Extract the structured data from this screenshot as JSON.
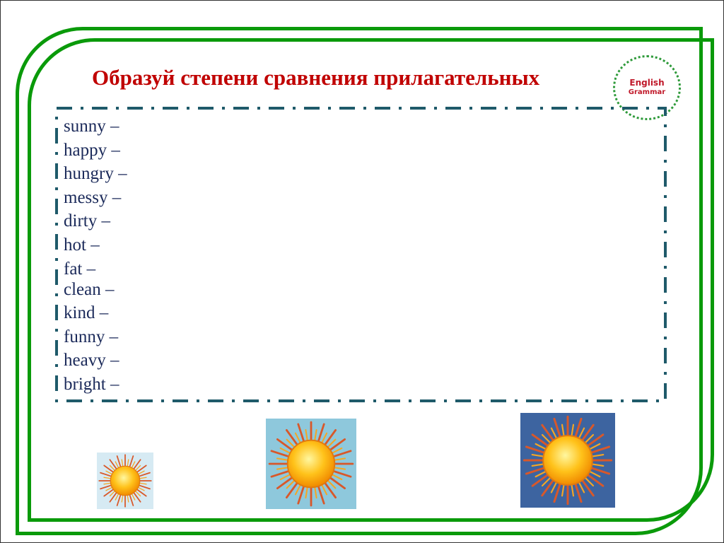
{
  "slide": {
    "title": "Образуй степени сравнения прилагательных",
    "badge": {
      "line1": "English",
      "line2": "Grammar"
    },
    "words": [
      "sunny –",
      "happy –",
      "hungry –",
      "messy –",
      "dirty –",
      "hot –",
      "fat –",
      "clean –",
      "kind –",
      "funny –",
      "heavy –",
      "bright –"
    ],
    "images": [
      {
        "name": "sun-small",
        "icon": "sun-icon",
        "background": "#d6eaf3"
      },
      {
        "name": "sun-medium",
        "icon": "sun-icon",
        "background": "#8ec8dc"
      },
      {
        "name": "sun-large",
        "icon": "sun-icon",
        "background": "#3d64a0"
      }
    ],
    "colors": {
      "title": "#c00000",
      "frame": "#0a9a0a",
      "dash_border": "#1f5a6a",
      "words": "#1b2a5a",
      "badge_border": "#2e9a3a",
      "badge_text": "#c0192a"
    }
  }
}
